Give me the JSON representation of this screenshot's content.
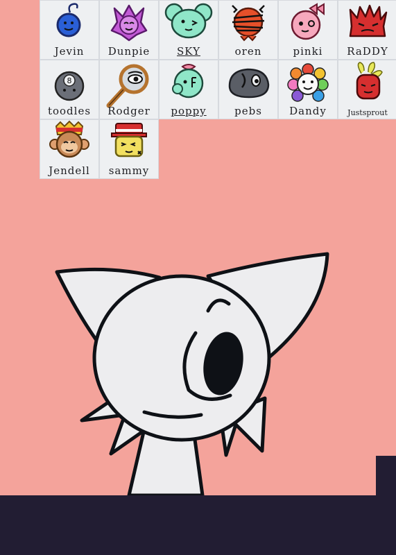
{
  "roster": {
    "characters": [
      {
        "name": "Jevin",
        "icon": "blue-bomb-face-icon",
        "color": "#2a5fd6"
      },
      {
        "name": "Dunpie",
        "icon": "purple-star-face-icon",
        "color": "#c25ad6"
      },
      {
        "name": "SKY",
        "icon": "mint-mouse-face-icon",
        "color": "#8fe6c8"
      },
      {
        "name": "oren",
        "icon": "orange-scribbled-face-icon",
        "color": "#e6502a"
      },
      {
        "name": "pinki",
        "icon": "pink-bow-face-icon",
        "color": "#f28ca8"
      },
      {
        "name": "RaDDY",
        "icon": "red-spiky-face-icon",
        "color": "#d62f2f"
      },
      {
        "name": "toodles",
        "icon": "gray-eight-ball-icon",
        "color": "#6b6f78"
      },
      {
        "name": "Rodger",
        "icon": "magnifying-glass-icon",
        "color": "#b5732e"
      },
      {
        "name": "poppy",
        "icon": "mint-bubble-face-icon",
        "color": "#8fe6c8"
      },
      {
        "name": "pebs",
        "icon": "gray-rock-face-icon",
        "color": "#5a5e66"
      },
      {
        "name": "Dandy",
        "icon": "rainbow-flower-face-icon",
        "color": "#f2c230"
      },
      {
        "name": "Justsprout",
        "icon": "red-sprout-face-icon",
        "color": "#d62f2f"
      },
      {
        "name": "Jendell",
        "icon": "crowned-monkey-face-icon",
        "color": "#e0a070"
      },
      {
        "name": "sammy",
        "icon": "hat-wearing-face-icon",
        "color": "#f2e060"
      }
    ]
  },
  "scene": {
    "background_color": "#f4a39b",
    "floor_color": "#221d33",
    "player_icon": "white-one-eyed-cat-character-icon",
    "player_color": "#ededef"
  }
}
